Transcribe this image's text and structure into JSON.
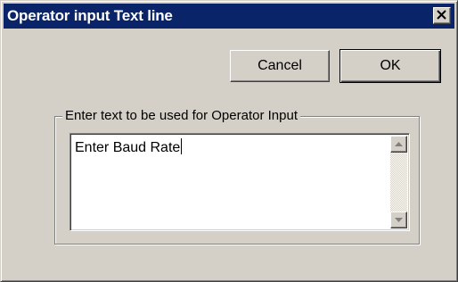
{
  "window": {
    "title": "Operator input Text line",
    "close_glyph": "close-icon"
  },
  "buttons": {
    "cancel_label": "Cancel",
    "ok_label": "OK"
  },
  "group": {
    "legend": "Enter text to be used for Operator Input"
  },
  "text_area": {
    "value": "Enter Baud Rate"
  },
  "colors": {
    "titlebar": "#0a246a",
    "face": "#d4d0c8"
  }
}
